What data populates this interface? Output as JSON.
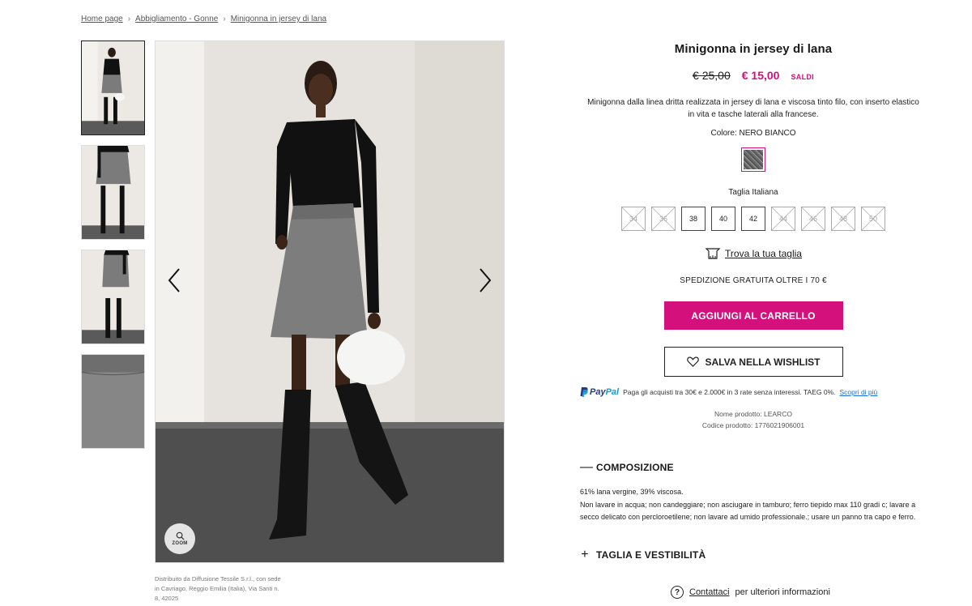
{
  "breadcrumb": {
    "items": [
      "Home page",
      "Abbigliamento - Gonne",
      "Minigonna in jersey di lana"
    ]
  },
  "gallery": {
    "thumbnail_count": 4,
    "zoom_label": "ZOOM",
    "distributor_text": "Distribuito da Diffusione Tessile S.r.l., con sede in Cavriago, Reggio Emilia (Italia), Via Santi n. 8, 42025"
  },
  "product": {
    "title": "Minigonna in jersey di lana",
    "old_price": "€ 25,00",
    "new_price": "€ 15,00",
    "sale_label": "SALDI",
    "description": "Minigonna dalla linea dritta realizzata in jersey di lana e viscosa tinto filo, con inserto elastico in vita e tasche laterali alla francese.",
    "color_label": "Colore: NERO BIANCO",
    "size_label": "Taglia Italiana",
    "sizes": [
      {
        "label": "34",
        "available": false
      },
      {
        "label": "36",
        "available": false
      },
      {
        "label": "38",
        "available": true
      },
      {
        "label": "40",
        "available": true
      },
      {
        "label": "42",
        "available": true
      },
      {
        "label": "44",
        "available": false
      },
      {
        "label": "46",
        "available": false
      },
      {
        "label": "48",
        "available": false
      },
      {
        "label": "50",
        "available": false
      }
    ],
    "size_guide": "Trova la tua taglia",
    "shipping": "SPEDIZIONE GRATUITA OLTRE I 70 €",
    "add_to_cart": "AGGIUNGI AL CARRELLO",
    "wishlist": "SALVA NELLA WISHLIST",
    "paypal": {
      "logo_part1": "Pay",
      "logo_part2": "Pal",
      "text": "Paga gli acquisti tra 30€ e 2.000€ in 3 rate senza interessi. TAEG 0%.",
      "link": "Scopri di più"
    },
    "product_name": "Nome prodotto: LEARCO",
    "product_code": "Codice prodotto:  1776021906001"
  },
  "sections": {
    "composition_title": "COMPOSIZIONE",
    "composition_mark": "—",
    "composition_text_1": "61% lana vergine, 39% viscosa.",
    "composition_text_2": "Non lavare in acqua; non candeggiare; non asciugare in tamburo; ferro tiepido max 110 gradi c; lavare a secco delicato con percloroetilene; non lavare ad umido professionale.; usare un panno tra capo e ferro.",
    "fit_title": "TAGLIA E VESTIBILITÀ",
    "fit_mark": "+"
  },
  "contact": {
    "icon": "?",
    "link": "Contattaci",
    "text": "per ulteriori informazioni"
  },
  "colors": {
    "accent": "#d4107c",
    "paypal_dark": "#253b80",
    "paypal_light": "#179bd7"
  }
}
